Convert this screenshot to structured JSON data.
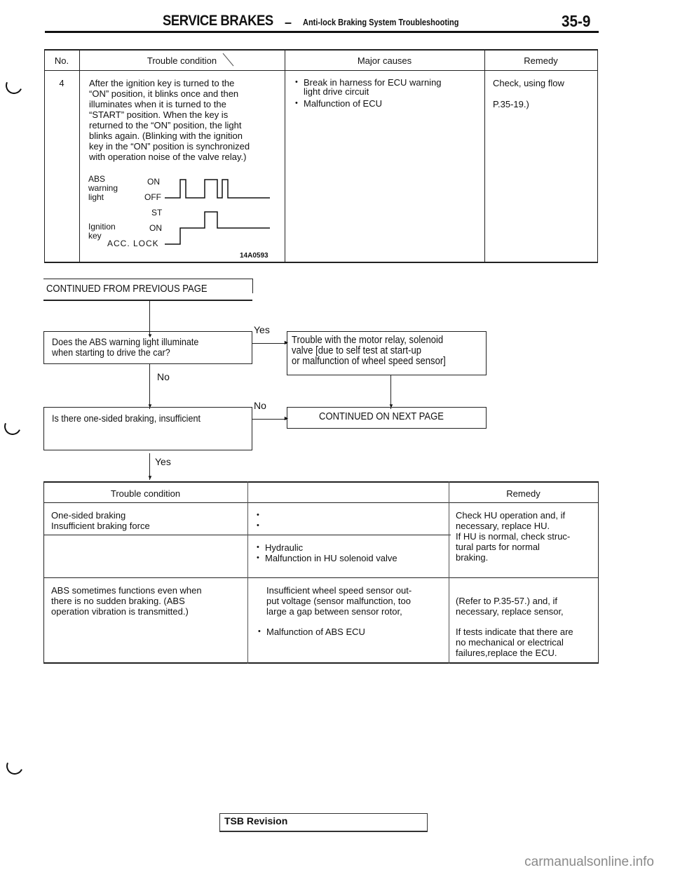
{
  "header": {
    "section": "SERVICE BRAKES",
    "dash": "–",
    "subtitle": "Anti-lock Braking System Troubleshooting",
    "page": "35-9"
  },
  "top_table": {
    "headers": [
      "No.",
      "Trouble condition",
      "Major causes",
      "Remedy"
    ],
    "row": {
      "no": "4",
      "condition": "After the ignition key is turned to the\n“ON” position, it blinks once and then\nilluminates when it is turned to the\n“START” position. When the key is\nreturned to the “ON” position, the light\nblinks again. (Blinking with the ignition\nkey in the “ON” position is synchronized\nwith operation noise of the valve relay.)",
      "causes": [
        "Break in harness for ECU warning\nlight drive circuit",
        "Malfunction of ECU"
      ],
      "remedy_line1": "Check, using flow",
      "remedy_line2": "P.35-19.)"
    },
    "timing_diagram": {
      "abs_label": "ABS\nwarning\nlight",
      "abs_on": "ON",
      "abs_off": "OFF",
      "key_label": "Ignition\nkey",
      "key_st": "ST",
      "key_on": "ON",
      "key_lock": "ACC. LOCK",
      "figure_id": "14A0593"
    }
  },
  "flow": {
    "continued_from": "CONTINUED FROM PREVIOUS PAGE",
    "q1": "Does the ABS warning light illuminate\nwhen starting to drive the car?",
    "q1_yes": "Yes",
    "q1_no": "No",
    "a1": "Trouble with the motor relay, solenoid\nvalve [due to self test at start-up\nor malfunction of wheel speed sensor]",
    "q2": "Is there one-sided braking, insufficient",
    "q2_no": "No",
    "q2_yes": "Yes",
    "continued_next": "CONTINUED ON NEXT PAGE"
  },
  "bottom_table": {
    "headers": [
      "Trouble condition",
      "",
      "Remedy"
    ],
    "rows": [
      {
        "condition": "One-sided braking\nInsufficient braking force",
        "causes_a": [
          "",
          ""
        ],
        "causes_b": [
          "Hydraulic",
          "Malfunction in HU solenoid valve"
        ],
        "remedy": "Check HU operation and, if\nnecessary, replace HU.\nIf HU is normal, check struc-\ntural parts for normal\nbraking."
      },
      {
        "condition": "ABS sometimes functions even when\nthere is no sudden braking. (ABS\noperation vibration is transmitted.)",
        "cause_text": "Insufficient wheel speed sensor out-\nput voltage (sensor malfunction, too\nlarge a gap between sensor rotor,",
        "cause_bullet": "Malfunction of ABS ECU",
        "remedy_a": "(Refer to P.35-57.) and, if\nnecessary, replace sensor,",
        "remedy_b": "If tests indicate that there are\nno mechanical or electrical\nfailures,replace the ECU."
      }
    ]
  },
  "footer": {
    "tsb": "TSB Revision",
    "watermark": "carmanualsonline.info"
  }
}
